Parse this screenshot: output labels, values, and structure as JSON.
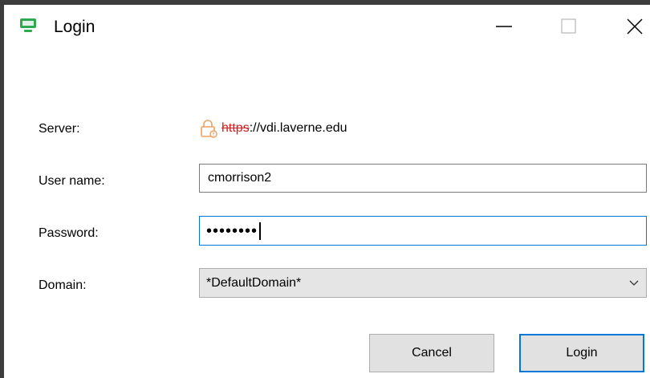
{
  "window": {
    "title": "Login",
    "controls": {
      "minimize": "minimize-icon",
      "maximize": "maximize-icon",
      "close": "close-icon"
    }
  },
  "form": {
    "server": {
      "label": "Server:",
      "scheme": "https",
      "rest": "://vdi.laverne.edu",
      "status_icon": "lock-warning-icon"
    },
    "username": {
      "label": "User name:",
      "value": "cmorrison2"
    },
    "password": {
      "label": "Password:",
      "masked_value": "••••••••"
    },
    "domain": {
      "label": "Domain:",
      "selected": "*DefaultDomain*"
    }
  },
  "buttons": {
    "cancel": "Cancel",
    "login": "Login"
  },
  "colors": {
    "accent": "#0078d7",
    "insecure_scheme": "#d21f1f",
    "app_icon": "#2fa84f",
    "lock_warning": "#f0a060"
  }
}
